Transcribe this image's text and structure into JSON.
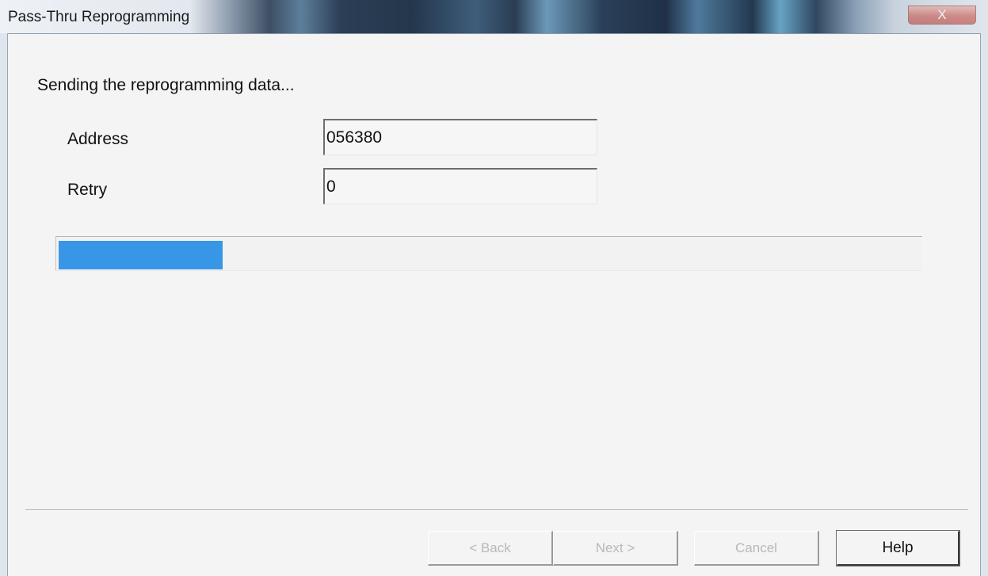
{
  "window": {
    "title": "Pass-Thru Reprogramming",
    "close_glyph": "X"
  },
  "status_message": "Sending the reprogramming data...",
  "fields": {
    "address": {
      "label": "Address",
      "value": "056380"
    },
    "retry": {
      "label": "Retry",
      "value": "0"
    }
  },
  "progress": {
    "fraction": 0.19,
    "color": "#3796e6"
  },
  "buttons": {
    "back": {
      "label": "< Back",
      "enabled": false
    },
    "next": {
      "label": "Next >",
      "enabled": false
    },
    "cancel": {
      "label": "Cancel",
      "enabled": false
    },
    "help": {
      "label": "Help",
      "enabled": true
    }
  }
}
